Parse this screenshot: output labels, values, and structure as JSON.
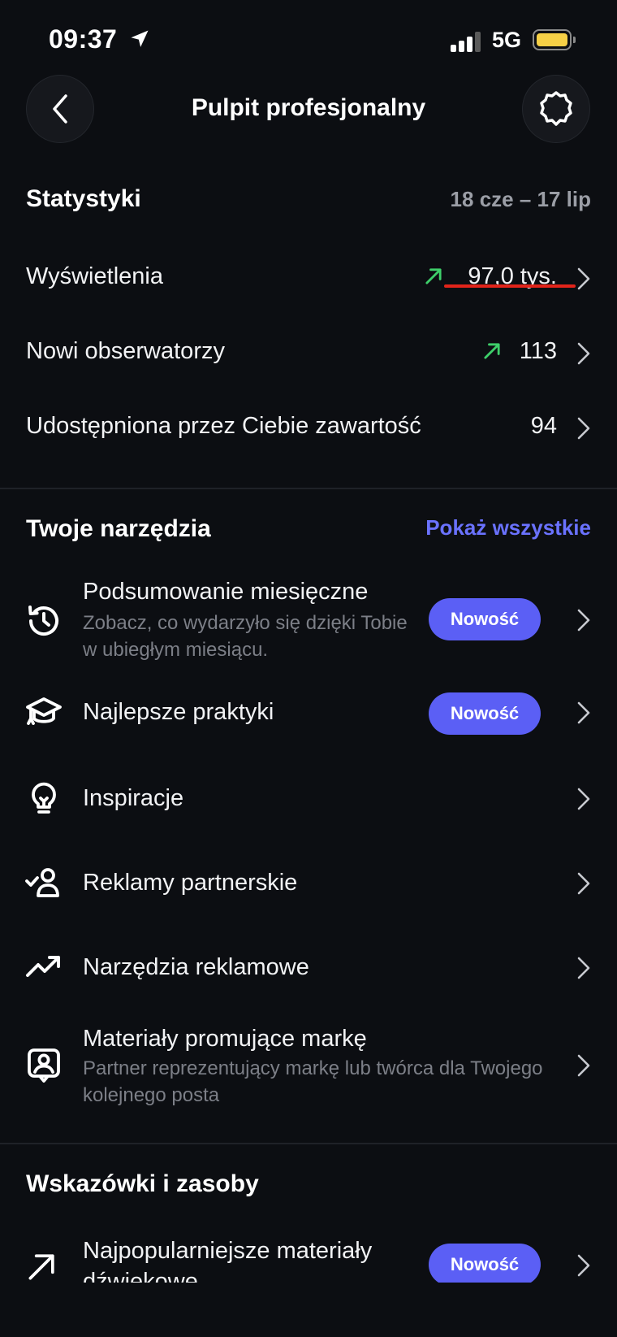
{
  "status_bar": {
    "time": "09:37",
    "network": "5G"
  },
  "header": {
    "title": "Pulpit profesjonalny"
  },
  "stats": {
    "title": "Statystyki",
    "date_range": "18 cze – 17 lip",
    "rows": [
      {
        "label": "Wyświetlenia",
        "value": "97,0 tys.",
        "trend": "up"
      },
      {
        "label": "Nowi obserwatorzy",
        "value": "113",
        "trend": "up"
      },
      {
        "label": "Udostępniona przez Ciebie zawartość",
        "value": "94"
      }
    ]
  },
  "tools": {
    "title": "Twoje narzędzia",
    "show_all": "Pokaż wszystkie",
    "items": [
      {
        "title": "Podsumowanie miesięczne",
        "subtitle": "Zobacz, co wydarzyło się dzięki Tobie w ubiegłym miesiącu.",
        "badge": "Nowość",
        "icon": "history-clock-icon"
      },
      {
        "title": "Najlepsze praktyki",
        "badge": "Nowość",
        "icon": "graduation-cap-icon"
      },
      {
        "title": "Inspiracje",
        "icon": "lightbulb-icon"
      },
      {
        "title": "Reklamy partnerskie",
        "icon": "user-check-icon"
      },
      {
        "title": "Narzędzia reklamowe",
        "icon": "trend-up-icon"
      },
      {
        "title": "Materiały promujące markę",
        "subtitle": "Partner reprezentujący markę lub twórca dla Twojego kolejnego posta",
        "icon": "brand-content-icon"
      }
    ]
  },
  "tips": {
    "title": "Wskazówki i zasoby",
    "items": [
      {
        "title": "Najpopularniejsze materiały dźwiękowe",
        "badge": "Nowość",
        "icon": "arrow-up-right-icon"
      }
    ]
  },
  "colors": {
    "background": "#0c0e12",
    "accent": "#5b5ff5",
    "link": "#6a72ff",
    "trend_up": "#3ecf6a",
    "annotation": "#e2241a"
  }
}
